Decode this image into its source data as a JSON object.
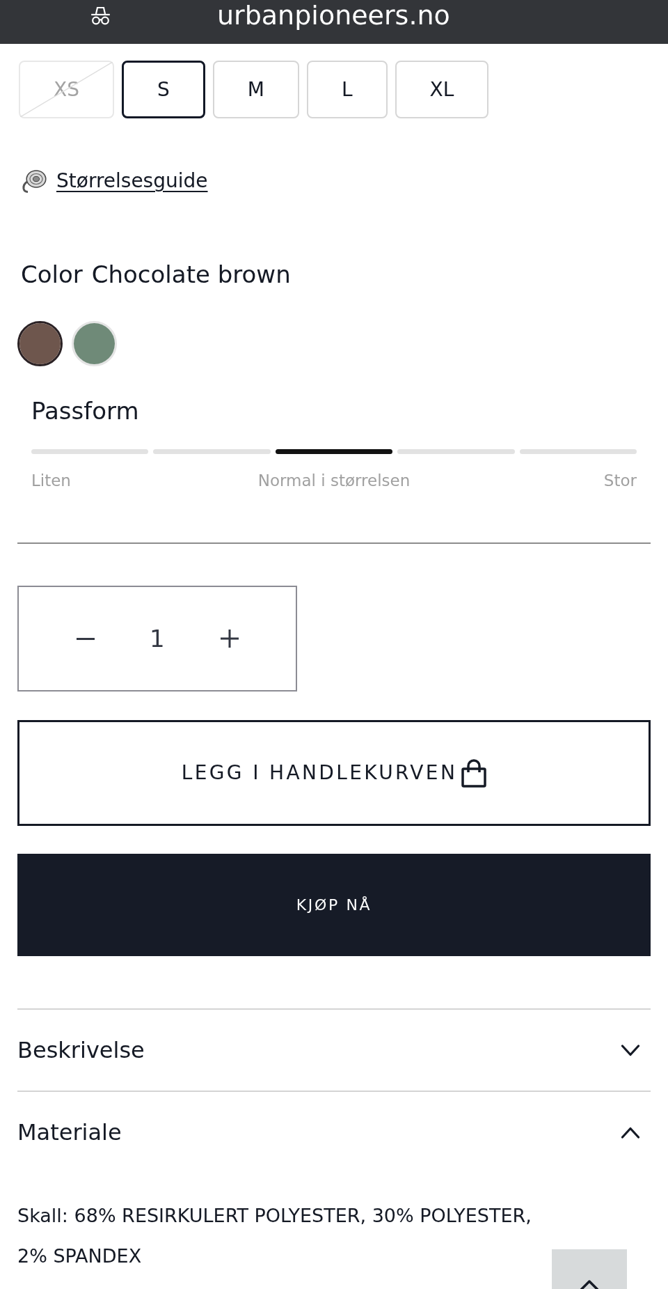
{
  "browser_bar": {
    "url": "urbanpioneers.no"
  },
  "sizes": [
    {
      "label": "XS",
      "selected": false,
      "disabled": true
    },
    {
      "label": "S",
      "selected": true,
      "disabled": false
    },
    {
      "label": "M",
      "selected": false,
      "disabled": false
    },
    {
      "label": "L",
      "selected": false,
      "disabled": false
    },
    {
      "label": "XL",
      "selected": false,
      "disabled": false
    }
  ],
  "size_guide": {
    "label": "Størrelsesguide"
  },
  "color": {
    "label": "Color",
    "value": "Chocolate brown",
    "swatches": [
      {
        "color": "#6e564d",
        "selected": true
      },
      {
        "color": "#6f8a78",
        "selected": false
      }
    ]
  },
  "fit": {
    "title": "Passform",
    "segments": [
      {
        "selected": false
      },
      {
        "selected": false
      },
      {
        "selected": true
      },
      {
        "selected": false
      },
      {
        "selected": false
      }
    ],
    "labels": [
      "Liten",
      "Normal i størrelsen",
      "Stor"
    ]
  },
  "quantity": {
    "value": "1"
  },
  "buttons": [
    {
      "label": "LEGG I HANDLEKURVEN",
      "kind": "outline"
    },
    {
      "label": "KJØP NÅ",
      "kind": "filled"
    }
  ],
  "accordion": [
    {
      "title": "Beskrivelse",
      "expanded": false
    },
    {
      "title": "Materiale",
      "expanded": true,
      "content": "Skall: 68% RESIRKULERT POLYESTER, 30% POLYESTER, 2% SPANDEX"
    }
  ]
}
